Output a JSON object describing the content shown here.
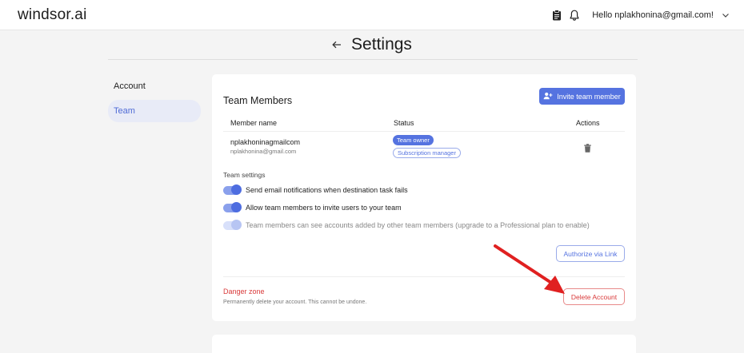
{
  "header": {
    "logo": "windsor.ai",
    "greeting": "Hello nplakhonina@gmail.com!",
    "icons": [
      "clipboard-icon",
      "bell-icon",
      "chevron-down-icon"
    ]
  },
  "page": {
    "title": "Settings",
    "back_icon": "arrow-left-icon"
  },
  "sidebar": {
    "items": [
      {
        "label": "Account",
        "active": false
      },
      {
        "label": "Team",
        "active": true
      }
    ]
  },
  "team": {
    "heading": "Team Members",
    "invite_label": "Invite team member",
    "columns": [
      "Member name",
      "Status",
      "Actions"
    ],
    "members": [
      {
        "name": "nplakhoninagmailcom",
        "email": "nplakhonina@gmail.com",
        "badges": [
          "Team owner",
          "Subscription manager"
        ]
      }
    ],
    "settings_label": "Team settings",
    "toggles": [
      {
        "label": "Send email notifications when destination task fails",
        "on": true,
        "disabled": false
      },
      {
        "label": "Allow team members to invite users to your team",
        "on": true,
        "disabled": false
      },
      {
        "label": "Team members can see accounts added by other team members (upgrade to a Professional plan to enable)",
        "on": true,
        "disabled": true
      }
    ],
    "authorize_label": "Authorize via Link"
  },
  "danger": {
    "title": "Danger zone",
    "text": "Permanently delete your account. This cannot be undone.",
    "delete_label": "Delete Account"
  },
  "colors": {
    "accent": "#5573e0",
    "danger": "#d93a3a",
    "annotation_arrow": "#e02020"
  }
}
